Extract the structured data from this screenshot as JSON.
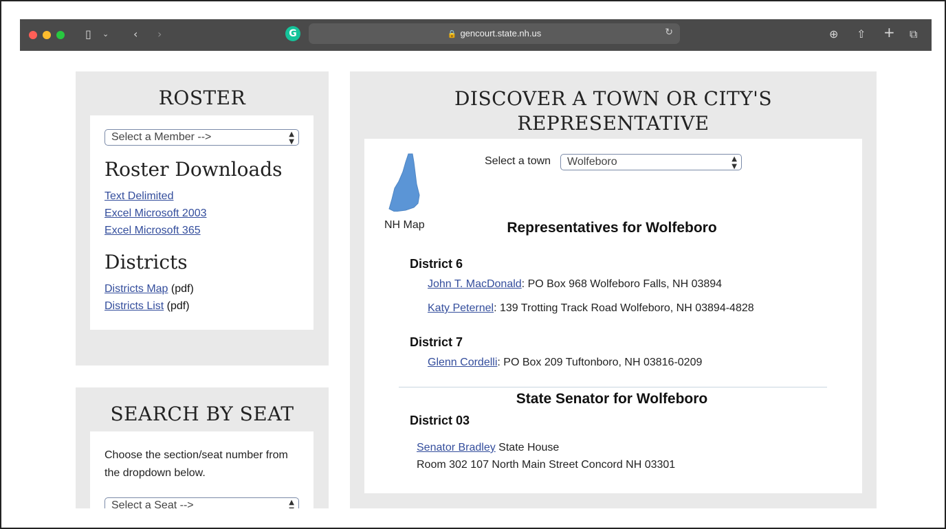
{
  "browser": {
    "url": "gencourt.state.nh.us",
    "grammarly_letter": "G"
  },
  "roster": {
    "title": "ROSTER",
    "member_select": "Select a Member -->",
    "downloads_heading": "Roster Downloads",
    "downloads": [
      "Text Delimited",
      "Excel Microsoft 2003",
      "Excel Microsoft 365"
    ],
    "districts_heading": "Districts",
    "districts_map_link": "Districts Map",
    "districts_map_suffix": " (pdf)",
    "districts_list_link": "Districts List",
    "districts_list_suffix": " (pdf)"
  },
  "search_seat": {
    "title": "SEARCH BY SEAT",
    "description": "Choose the section/seat number from the dropdown below.",
    "seat_select": "Select a Seat -->"
  },
  "discover": {
    "title_line1": "DISCOVER A TOWN OR CITY'S",
    "title_line2": "REPRESENTATIVE",
    "map_label": "NH Map",
    "select_label": "Select a town",
    "town_value": "Wolfeboro",
    "reps_heading": "Representatives for Wolfeboro",
    "districts": [
      {
        "name": "District 6",
        "reps": [
          {
            "name": "John T. MacDonald",
            "address": ":  PO Box 968  Wolfeboro Falls,  NH  03894"
          },
          {
            "name": "Katy Peternel",
            "address": ":  139 Trotting Track Road  Wolfeboro,  NH  03894-4828"
          }
        ]
      },
      {
        "name": "District 7",
        "reps": [
          {
            "name": "Glenn Cordelli",
            "address": ":  PO Box 209  Tuftonboro,  NH  03816-0209"
          }
        ]
      }
    ],
    "senator_heading": "State Senator for Wolfeboro",
    "senator_district": "District 03",
    "senator_name": "Senator Bradley",
    "senator_addr1": "  State House",
    "senator_addr2": "Room 302  107 North Main Street Concord NH  03301"
  }
}
